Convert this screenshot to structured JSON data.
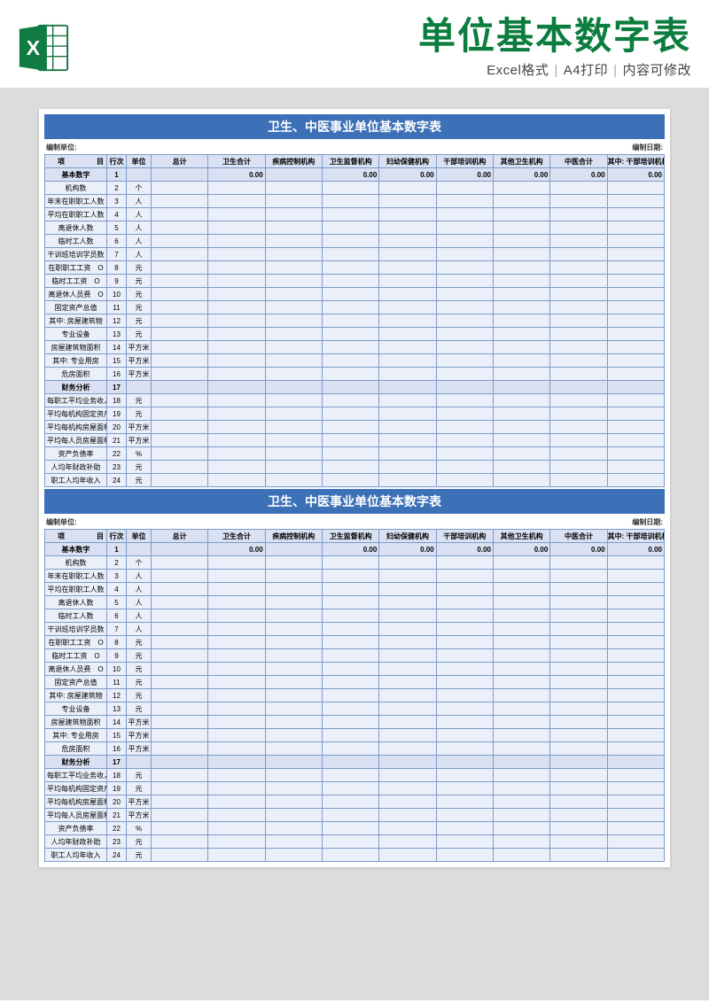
{
  "header": {
    "title_main": "单位基本数字表",
    "subtitle_parts": [
      "Excel格式",
      "A4打印",
      "内容可修改"
    ]
  },
  "table": {
    "title": "卫生、中医事业单位基本数字表",
    "meta_left": "编制单位:",
    "meta_right": "编制日期:",
    "headers": [
      "项目",
      "行次",
      "单位",
      "总计",
      "卫生合计",
      "疾病控制机构",
      "卫生监督机构",
      "妇幼保健机构",
      "干部培训机构",
      "其他卫生机构",
      "中医合计",
      "其中: 干部培训机构"
    ],
    "rows": [
      {
        "item": "基本数字",
        "row": "1",
        "unit": "",
        "section": true,
        "vals": [
          "",
          "0.00",
          "",
          "0.00",
          "0.00",
          "0.00",
          "0.00",
          "0.00",
          "0.00"
        ]
      },
      {
        "item": "机构数",
        "row": "2",
        "unit": "个"
      },
      {
        "item": "年末在职职工人数",
        "row": "3",
        "unit": "人"
      },
      {
        "item": "平均在职职工人数",
        "row": "4",
        "unit": "人"
      },
      {
        "item": "离退休人数",
        "row": "5",
        "unit": "人"
      },
      {
        "item": "临时工人数",
        "row": "6",
        "unit": "人"
      },
      {
        "item": "干训班培训学员数",
        "row": "7",
        "unit": "人"
      },
      {
        "item": "在职职工工资　O",
        "row": "8",
        "unit": "元"
      },
      {
        "item": "临时工工资　O",
        "row": "9",
        "unit": "元"
      },
      {
        "item": "离退休人员费　O",
        "row": "10",
        "unit": "元"
      },
      {
        "item": "固定资产总值",
        "row": "11",
        "unit": "元"
      },
      {
        "item": "其中: 房屋建筑物",
        "row": "12",
        "unit": "元"
      },
      {
        "item": "专业设备",
        "row": "13",
        "unit": "元"
      },
      {
        "item": "房屋建筑物面积",
        "row": "14",
        "unit": "平方米"
      },
      {
        "item": "其中: 专业用房",
        "row": "15",
        "unit": "平方米"
      },
      {
        "item": "危房面积",
        "row": "16",
        "unit": "平方米"
      },
      {
        "item": "财务分析",
        "row": "17",
        "unit": "",
        "section": true
      },
      {
        "item": "每职工平均业务收入",
        "row": "18",
        "unit": "元"
      },
      {
        "item": "平均每机构固定资产",
        "row": "19",
        "unit": "元"
      },
      {
        "item": "平均每机构房屋面积",
        "row": "20",
        "unit": "平方米"
      },
      {
        "item": "平均每人员房屋面积",
        "row": "21",
        "unit": "平方米"
      },
      {
        "item": "资产负债率",
        "row": "22",
        "unit": "%"
      },
      {
        "item": "人均年财政补助",
        "row": "23",
        "unit": "元"
      },
      {
        "item": "职工人均年收入",
        "row": "24",
        "unit": "元"
      }
    ]
  }
}
